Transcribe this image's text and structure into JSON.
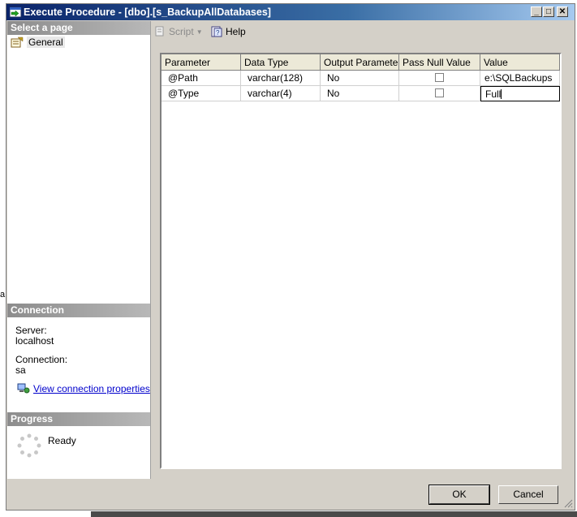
{
  "window": {
    "title": "Execute Procedure - [dbo].[s_BackupAllDatabases]",
    "minimize": "_",
    "maximize": "□",
    "close": "✕"
  },
  "left": {
    "select_page_header": "Select a page",
    "pages": [
      {
        "label": "General",
        "icon": "properties-page-icon"
      }
    ],
    "connection_header": "Connection",
    "server_label": "Server:",
    "server_value": "localhost",
    "connection_label": "Connection:",
    "connection_value": "sa",
    "view_connection_link": "View connection properties",
    "progress_header": "Progress",
    "progress_status": "Ready"
  },
  "toolbar": {
    "script_label": "Script",
    "help_label": "Help"
  },
  "grid": {
    "columns": [
      "Parameter",
      "Data Type",
      "Output Parameter",
      "Pass Null Value",
      "Value"
    ],
    "rows": [
      {
        "parameter": "@Path",
        "data_type": "varchar(128)",
        "output": "No",
        "pass_null": false,
        "value": "e:\\SQLBackups"
      },
      {
        "parameter": "@Type",
        "data_type": "varchar(4)",
        "output": "No",
        "pass_null": false,
        "value": "Full"
      }
    ]
  },
  "buttons": {
    "ok": "OK",
    "cancel": "Cancel"
  },
  "background": {
    "left_mark": "a"
  }
}
